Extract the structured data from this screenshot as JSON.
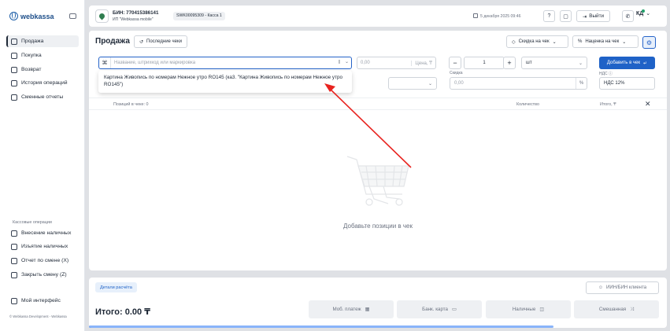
{
  "brand": {
    "name": "webkassa"
  },
  "sidebar": {
    "items": [
      {
        "label": "Продажа",
        "icon": "receipt-icon"
      },
      {
        "label": "Покупка",
        "icon": "box-icon"
      },
      {
        "label": "Возврат",
        "icon": "return-icon"
      },
      {
        "label": "История операций",
        "icon": "history-icon"
      },
      {
        "label": "Сменные отчеты",
        "icon": "report-icon"
      }
    ],
    "cash_section_label": "Кассовые операции",
    "cash_items": [
      {
        "label": "Внесение наличных",
        "icon": "cash-in-icon"
      },
      {
        "label": "Изъятие наличных",
        "icon": "cash-out-icon"
      },
      {
        "label": "Отчет по смене (X)",
        "icon": "x-report-icon"
      },
      {
        "label": "Закрыть смену (Z)",
        "icon": "z-report-icon"
      }
    ],
    "interface_item": {
      "label": "Мой интерфейс",
      "icon": "interface-icon"
    },
    "footer": "© Webkassa Development - Webkassa"
  },
  "header": {
    "bin": "БИН: 770415386141",
    "org_name": "ИП \"Webkassa mobile\"",
    "kassa": "SWK00095309 - Касса 1",
    "date": "5 декабря 2025 09:46",
    "exit_label": "Выйти",
    "user_initials": "КД"
  },
  "sale": {
    "title": "Продажа",
    "recent_checks_label": "Последние чеки",
    "discount_check_label": "Скидка на чек",
    "markup_check_label": "Наценка на чек",
    "search_placeholder": "Название, штрихкод или маркировка",
    "price_placeholder": "0,00",
    "price_unit": "Цена, ₸",
    "quantity": "1",
    "unit": "шт",
    "add_button_label": "Добавить в чек",
    "discount_label": "Скидка",
    "discount_placeholder": "0,00",
    "discount_unit": "%",
    "nds_label": "НДС",
    "nds_value": "НДС 12%",
    "suggestion": "Картина Живопись по номерам Нежное утро RO145 (ка3. \"Картина Живопись по номерам Нежное утро RO145\")",
    "table_headers": {
      "positions": "Позиций в чеке: 0",
      "quantity": "Количество",
      "total": "Итого, ₸"
    },
    "empty_text": "Добавьте позиции в чек"
  },
  "footer_bar": {
    "details_label": "Детали расчёта",
    "client_label": "ИИН/БИН клиента",
    "total": "Итого: 0.00 ₸",
    "pay_buttons": [
      {
        "label": "Моб. платеж",
        "icon": "qr-icon"
      },
      {
        "label": "Банк. карта",
        "icon": "card-icon"
      },
      {
        "label": "Наличные",
        "icon": "cash-icon"
      },
      {
        "label": "Смешанная",
        "icon": "mixed-icon"
      }
    ]
  },
  "colors": {
    "accent": "#1f62c7",
    "arrow": "#e8231f",
    "background": "#dfe1e5"
  }
}
